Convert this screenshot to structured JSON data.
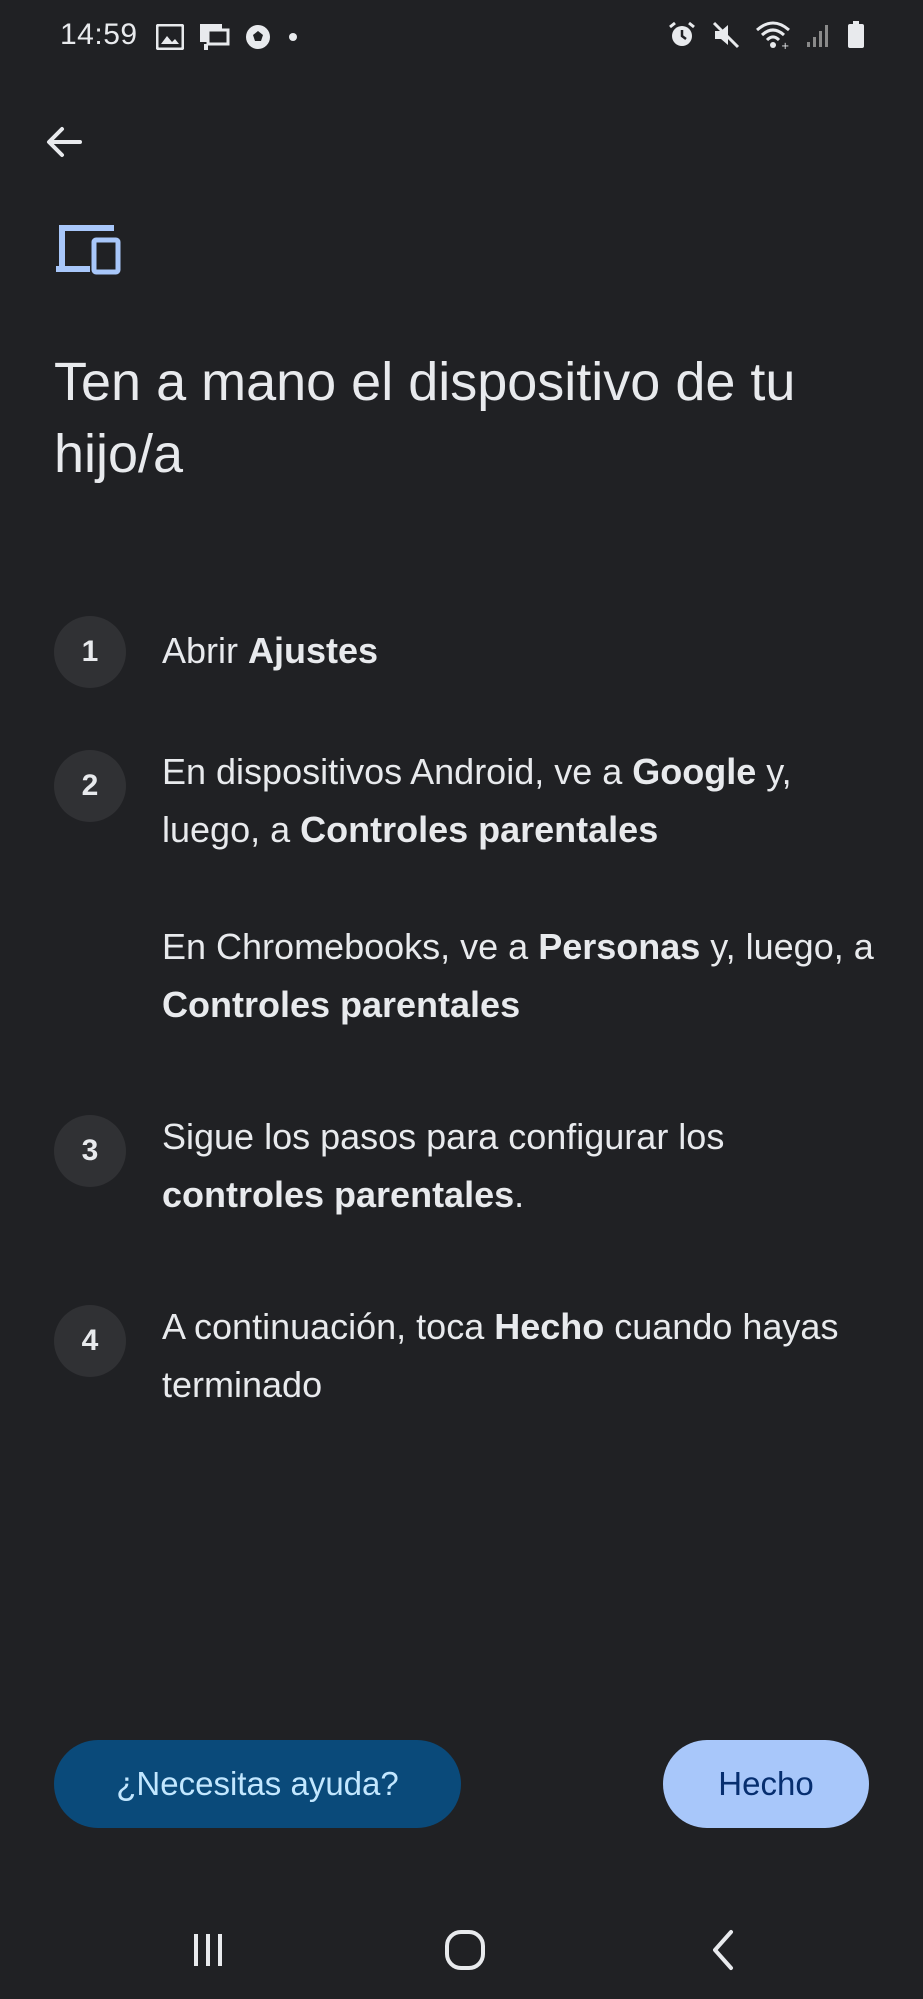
{
  "status_bar": {
    "time": "14:59",
    "left_icons": [
      "image-icon",
      "cast-icon",
      "soccer-ball-icon",
      "dot-icon"
    ],
    "right_icons": [
      "alarm-icon",
      "mute-icon",
      "wifi-icon",
      "signal-icon",
      "battery-icon"
    ]
  },
  "page": {
    "title": "Ten a mano el dispositivo de tu hijo/a",
    "accent_color": "#a8c7fa"
  },
  "steps": [
    {
      "number": "1",
      "parts": [
        [
          "Abrir ",
          false
        ],
        [
          "Ajustes",
          true
        ]
      ]
    },
    {
      "number": "2",
      "parts": [
        [
          "En dispositivos Android, ve a ",
          false
        ],
        [
          "Google",
          true
        ],
        [
          " y, luego, a ",
          false
        ],
        [
          "Controles parentales",
          true
        ]
      ]
    },
    {
      "number": "",
      "parts": [
        [
          "En Chromebooks, ve a ",
          false
        ],
        [
          "Personas",
          true
        ],
        [
          " y, luego, a ",
          false
        ],
        [
          "Controles parentales",
          true
        ]
      ]
    },
    {
      "number": "3",
      "parts": [
        [
          "Sigue los pasos para configurar los ",
          false
        ],
        [
          "controles parentales",
          true
        ],
        [
          ".",
          false
        ]
      ]
    },
    {
      "number": "4",
      "parts": [
        [
          "A continuación, toca ",
          false
        ],
        [
          "Hecho",
          true
        ],
        [
          " cuando hayas terminado",
          false
        ]
      ]
    }
  ],
  "buttons": {
    "help_label": "¿Necesitas ayuda?",
    "done_label": "Hecho"
  },
  "nav": {
    "icons": [
      "recent-apps-icon",
      "home-icon",
      "back-nav-icon"
    ]
  }
}
